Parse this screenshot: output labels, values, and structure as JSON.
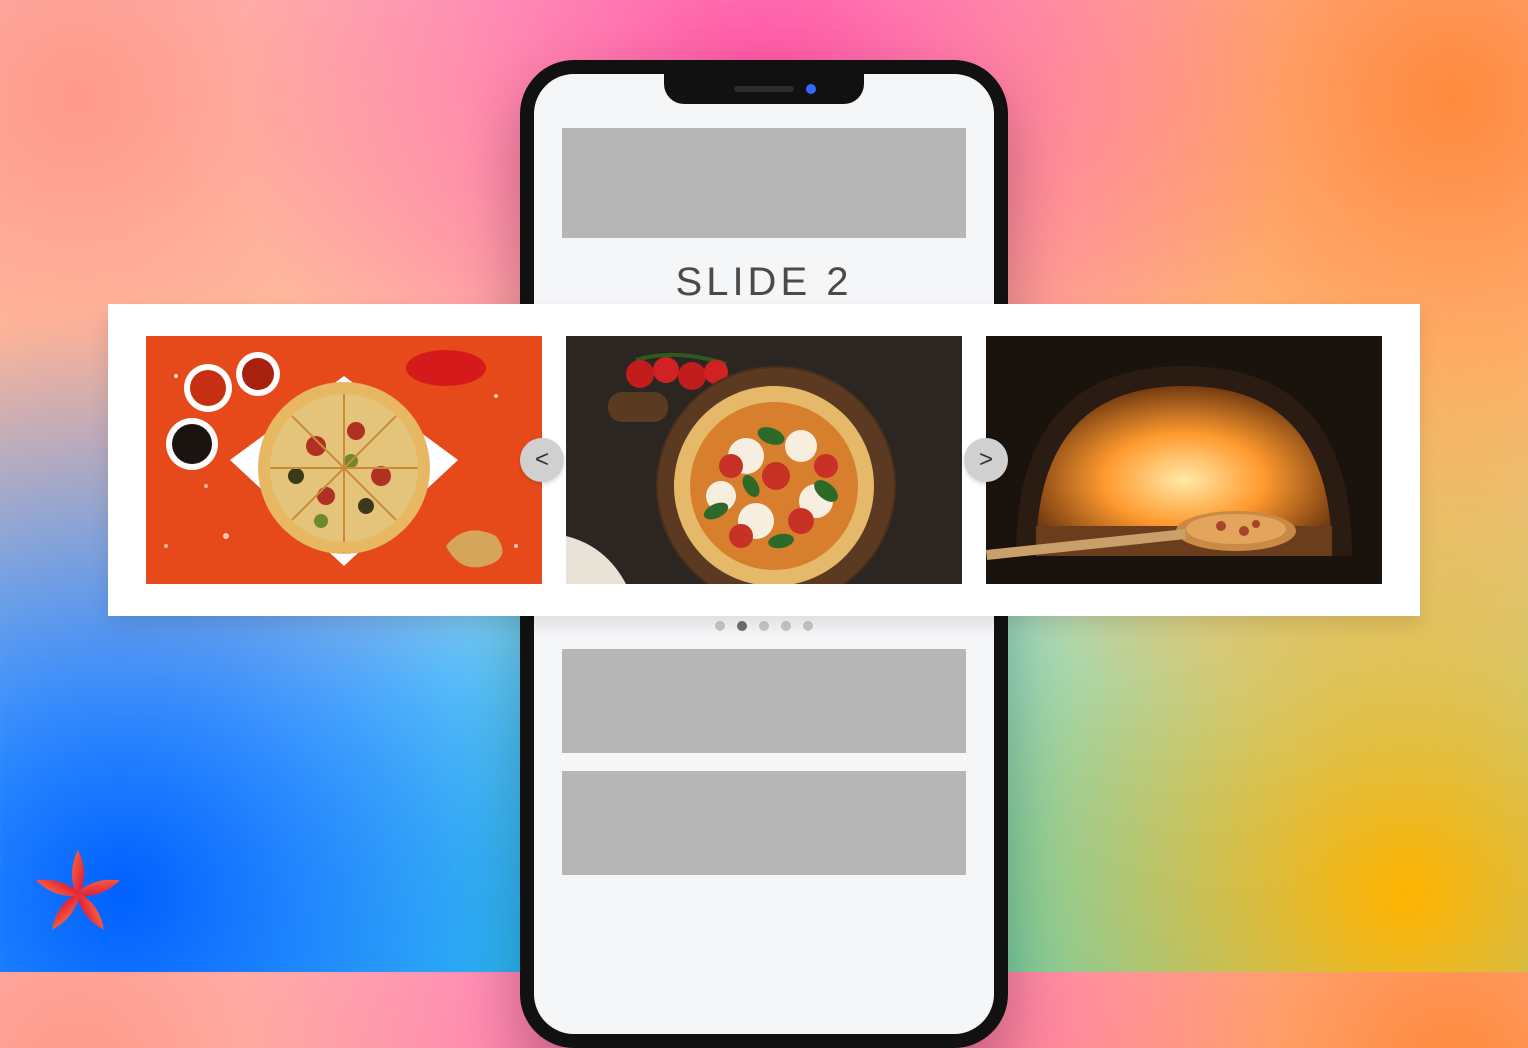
{
  "carousel": {
    "title": "SLIDE 2",
    "current_index": 1,
    "total_slides": 5,
    "prev_glyph": "<",
    "next_glyph": ">",
    "slides": [
      {
        "name": "pizza-orange",
        "alt": "Pizza on orange background with bowls of sauce"
      },
      {
        "name": "pizza-board",
        "alt": "Margherita pizza on wooden board with cherry tomatoes"
      },
      {
        "name": "pizza-oven",
        "alt": "Pizza baking inside a wood-fired oven"
      }
    ]
  },
  "logo": {
    "name": "asterisk-logo"
  }
}
